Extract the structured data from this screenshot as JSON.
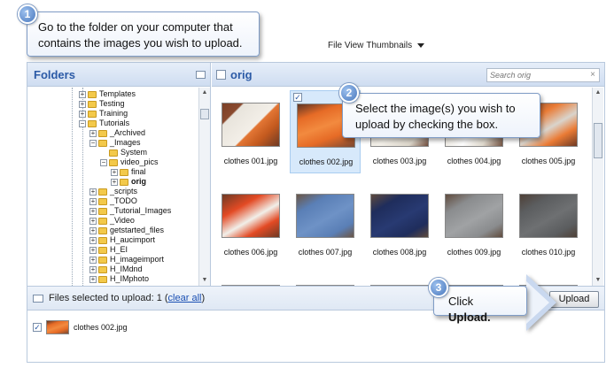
{
  "callouts": {
    "one": {
      "number": "1",
      "text": "Go to the folder on your computer that contains the images you wish to upload."
    },
    "two": {
      "number": "2",
      "text": "Select the image(s) you wish to upload by checking the box."
    },
    "three": {
      "number": "3",
      "prefix": "Click ",
      "bold": "Upload."
    }
  },
  "file_view": {
    "label": "File View",
    "selected": "Thumbnails"
  },
  "folders": {
    "title": "Folders",
    "items": [
      {
        "label": "Templates",
        "level": 0,
        "expander": "+"
      },
      {
        "label": "Testing",
        "level": 0,
        "expander": "+"
      },
      {
        "label": "Training",
        "level": 0,
        "expander": "+"
      },
      {
        "label": "Tutorials",
        "level": 0,
        "expander": "-"
      },
      {
        "label": "_Archived",
        "level": 1,
        "expander": "+"
      },
      {
        "label": "_Images",
        "level": 1,
        "expander": "-"
      },
      {
        "label": "System",
        "level": 2,
        "expander": ""
      },
      {
        "label": "video_pics",
        "level": 2,
        "expander": "-"
      },
      {
        "label": "final",
        "level": 3,
        "expander": "+"
      },
      {
        "label": "orig",
        "level": 3,
        "expander": "+",
        "selected": true
      },
      {
        "label": "_scripts",
        "level": 1,
        "expander": "+"
      },
      {
        "label": "_TODO",
        "level": 1,
        "expander": "+"
      },
      {
        "label": "_Tutorial_Images",
        "level": 1,
        "expander": "+"
      },
      {
        "label": "_Video",
        "level": 1,
        "expander": "+"
      },
      {
        "label": "getstarted_files",
        "level": 1,
        "expander": "+"
      },
      {
        "label": "H_aucimport",
        "level": 1,
        "expander": "+"
      },
      {
        "label": "H_EI",
        "level": 1,
        "expander": "+"
      },
      {
        "label": "H_imageimport",
        "level": 1,
        "expander": "+"
      },
      {
        "label": "H_IMdnd",
        "level": 1,
        "expander": "+"
      },
      {
        "label": "H_IMphoto",
        "level": 1,
        "expander": "+"
      }
    ]
  },
  "main": {
    "title": "orig",
    "search_placeholder": "Search orig",
    "search_clear": "×",
    "thumbnails": [
      {
        "label": "clothes 001.jpg",
        "photo": "ph-orange-white",
        "selected": false
      },
      {
        "label": "clothes 002.jpg",
        "photo": "ph-orange",
        "selected": true
      },
      {
        "label": "clothes 003.jpg",
        "photo": "ph-white",
        "selected": false
      },
      {
        "label": "clothes 004.jpg",
        "photo": "ph-white2",
        "selected": false
      },
      {
        "label": "clothes 005.jpg",
        "photo": "ph-orange2",
        "selected": false
      },
      {
        "label": "clothes 006.jpg",
        "photo": "ph-red",
        "selected": false
      },
      {
        "label": "clothes 007.jpg",
        "photo": "ph-blue",
        "selected": false
      },
      {
        "label": "clothes 008.jpg",
        "photo": "ph-navy",
        "selected": false
      },
      {
        "label": "clothes 009.jpg",
        "photo": "ph-grey",
        "selected": false
      },
      {
        "label": "clothes 010.jpg",
        "photo": "ph-darkgrey",
        "selected": false
      },
      {
        "label": "",
        "photo": "ph-mixed",
        "selected": false
      },
      {
        "label": "",
        "photo": "ph-black",
        "selected": false
      },
      {
        "label": "",
        "photo": "ph-mixed",
        "selected": false
      },
      {
        "label": "",
        "photo": "ph-white",
        "selected": false
      },
      {
        "label": "",
        "photo": "ph-grey",
        "selected": false
      }
    ]
  },
  "selection_bar": {
    "prefix": "Files selected to upload: ",
    "count": "1",
    "open_paren": " (",
    "clear_all": "clear all",
    "close_paren": ")",
    "upload_label": "Upload"
  },
  "upload_list": [
    {
      "label": "clothes 002.jpg",
      "photo": "ph-orange"
    }
  ]
}
